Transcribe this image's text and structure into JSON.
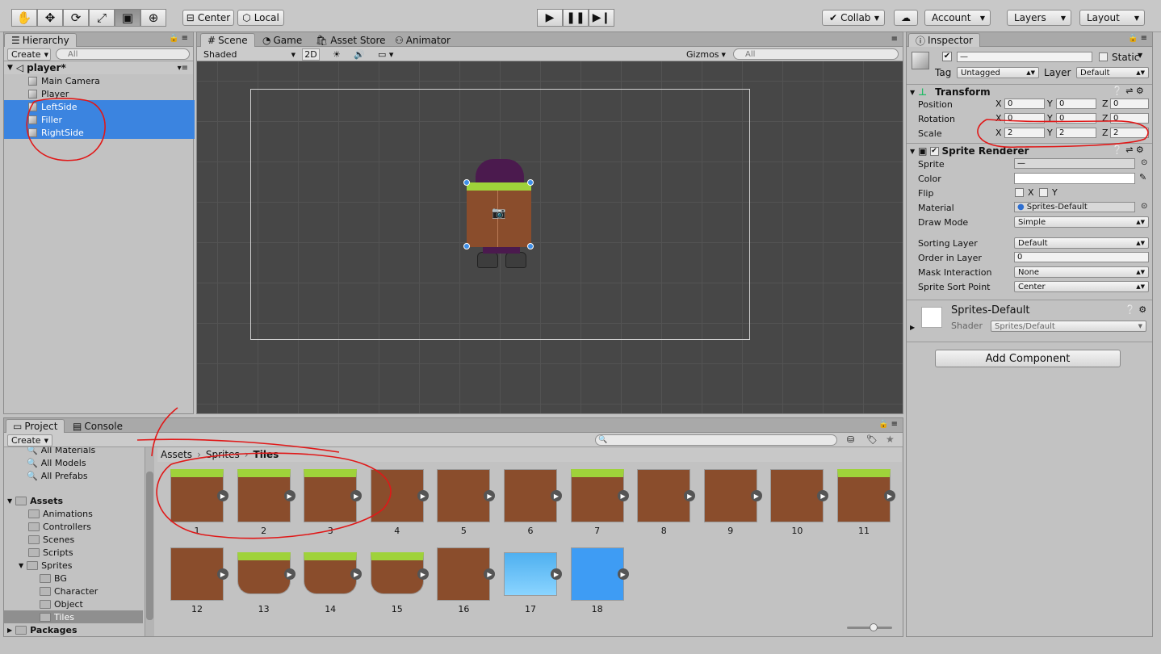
{
  "toolbar": {
    "tools": [
      "hand-tool",
      "move-tool",
      "rotate-tool",
      "scale-tool",
      "rect-tool",
      "transform-tool"
    ],
    "center_label": "Center",
    "local_label": "Local",
    "collab_label": "Collab",
    "account_label": "Account",
    "layers_label": "Layers",
    "layout_label": "Layout"
  },
  "hierarchy": {
    "tab": "Hierarchy",
    "create_label": "Create",
    "search_placeholder": "All",
    "scene_name": "player*",
    "items": [
      {
        "label": "Main Camera",
        "selected": false
      },
      {
        "label": "Player",
        "selected": false
      },
      {
        "label": "LeftSide",
        "selected": true
      },
      {
        "label": "Filler",
        "selected": true
      },
      {
        "label": "RightSide",
        "selected": true
      }
    ]
  },
  "scene": {
    "tabs": [
      "Scene",
      "Game",
      "Asset Store",
      "Animator"
    ],
    "shading_mode": "Shaded",
    "mode_2d": "2D",
    "gizmos_label": "Gizmos",
    "search_placeholder": "All"
  },
  "inspector": {
    "tab": "Inspector",
    "name_value": "—",
    "static_label": "Static",
    "tag_label": "Tag",
    "tag_value": "Untagged",
    "layer_label": "Layer",
    "layer_value": "Default",
    "transform": {
      "title": "Transform",
      "position_label": "Position",
      "rotation_label": "Rotation",
      "scale_label": "Scale",
      "position": [
        "0",
        "0",
        "0"
      ],
      "rotation": [
        "0",
        "0",
        "0"
      ],
      "scale": [
        "2",
        "2",
        "2"
      ],
      "axes": [
        "X",
        "Y",
        "Z"
      ]
    },
    "sprite_renderer": {
      "title": "Sprite Renderer",
      "sprite_label": "Sprite",
      "sprite_value": "—",
      "color_label": "Color",
      "flip_label": "Flip",
      "flip_x": "X",
      "flip_y": "Y",
      "material_label": "Material",
      "material_value": "Sprites-Default",
      "draw_mode_label": "Draw Mode",
      "draw_mode_value": "Simple",
      "sorting_layer_label": "Sorting Layer",
      "sorting_layer_value": "Default",
      "order_label": "Order in Layer",
      "order_value": "0",
      "mask_label": "Mask Interaction",
      "mask_value": "None",
      "sort_point_label": "Sprite Sort Point",
      "sort_point_value": "Center"
    },
    "material": {
      "name": "Sprites-Default",
      "shader_label": "Shader",
      "shader_value": "Sprites/Default"
    },
    "add_component_label": "Add Component"
  },
  "project": {
    "tabs": [
      "Project",
      "Console"
    ],
    "create_label": "Create",
    "favorites": [
      "All Materials",
      "All Models",
      "All Prefabs"
    ],
    "tree": [
      {
        "label": "Assets",
        "level": 0,
        "bold": true
      },
      {
        "label": "Animations",
        "level": 1
      },
      {
        "label": "Controllers",
        "level": 1
      },
      {
        "label": "Scenes",
        "level": 1
      },
      {
        "label": "Scripts",
        "level": 1
      },
      {
        "label": "Sprites",
        "level": 1
      },
      {
        "label": "BG",
        "level": 2
      },
      {
        "label": "Character",
        "level": 2
      },
      {
        "label": "Object",
        "level": 2
      },
      {
        "label": "Tiles",
        "level": 2,
        "selected": true
      },
      {
        "label": "Packages",
        "level": 0,
        "bold": true
      }
    ],
    "breadcrumb": [
      "Assets",
      "Sprites",
      "Tiles"
    ],
    "tiles": [
      "1",
      "2",
      "3",
      "4",
      "5",
      "6",
      "7",
      "8",
      "9",
      "10",
      "11",
      "12",
      "13",
      "14",
      "15",
      "16",
      "17",
      "18"
    ]
  },
  "colors": {
    "selection": "#3b84e0",
    "scene_bg": "#474747",
    "dirt": "#8a4d2c",
    "grass": "#9fd23a",
    "water": "#4fb0f0",
    "annotation": "#e01818"
  }
}
